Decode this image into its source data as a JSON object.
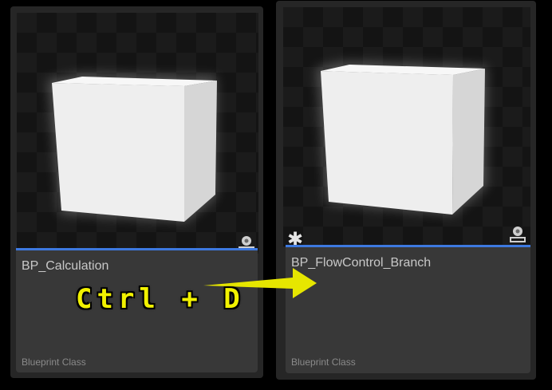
{
  "assets": [
    {
      "name": "BP_Calculation",
      "type": "Blueprint Class",
      "badge_icon": "map-pin-icon",
      "modified": false
    },
    {
      "name": "BP_FlowControl_Branch",
      "type": "Blueprint Class",
      "badge_icon": "map-pin-icon",
      "modified": true,
      "modified_glyph": "✱"
    }
  ],
  "annotation": {
    "shortcut": "Ctrl + D",
    "arrow_color": "#e6e600"
  },
  "colors": {
    "accent_line": "#3d79e0",
    "tile_bg": "#383838"
  }
}
